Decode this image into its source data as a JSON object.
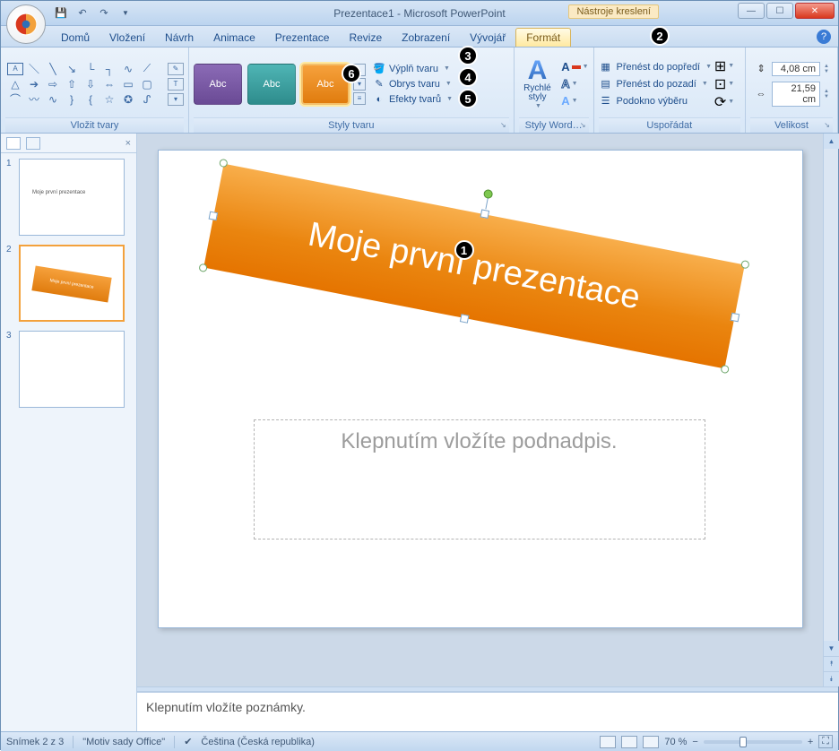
{
  "window": {
    "title": "Prezentace1 - Microsoft PowerPoint",
    "contextual_tab_label": "Nástroje kreslení"
  },
  "qat": {
    "save": "💾",
    "undo": "↶",
    "redo": "↷",
    "sep": "▾"
  },
  "tabs": {
    "items": [
      "Domů",
      "Vložení",
      "Návrh",
      "Animace",
      "Prezentace",
      "Revize",
      "Zobrazení",
      "Vývojář",
      "Formát"
    ],
    "active_index": 8
  },
  "ribbon": {
    "insert_shapes": {
      "label": "Vložit tvary"
    },
    "shape_styles": {
      "label": "Styly tvaru",
      "swatches": [
        "Abc",
        "Abc",
        "Abc"
      ],
      "fill": "Výplň tvaru",
      "outline": "Obrys tvaru",
      "effects": "Efekty tvarů"
    },
    "wordart": {
      "label": "Styly Word…",
      "quick_styles": "Rychlé styly"
    },
    "arrange": {
      "label": "Uspořádat",
      "bring_front": "Přenést do popředí",
      "send_back": "Přenést do pozadí",
      "selection_pane": "Podokno výběru"
    },
    "size": {
      "label": "Velikost",
      "height": "4,08 cm",
      "width": "21,59 cm"
    }
  },
  "slides": {
    "count": 3,
    "current": 2,
    "thumb1_text": "Moje první prezentace",
    "thumb2_text": "Moje první prezentace"
  },
  "canvas": {
    "title_text": "Moje první prezentace",
    "subtitle_placeholder": "Klepnutím vložíte podnadpis."
  },
  "notes": {
    "placeholder": "Klepnutím vložíte poznámky."
  },
  "status": {
    "slide_info": "Snímek 2 z 3",
    "theme": "\"Motiv sady Office\"",
    "language": "Čeština (Česká republika)",
    "zoom": "70 %"
  },
  "callouts": {
    "c1": "1",
    "c2": "2",
    "c3": "3",
    "c4": "4",
    "c5": "5",
    "c6": "6"
  },
  "colors": {
    "accent_orange": "#ee8a17"
  }
}
